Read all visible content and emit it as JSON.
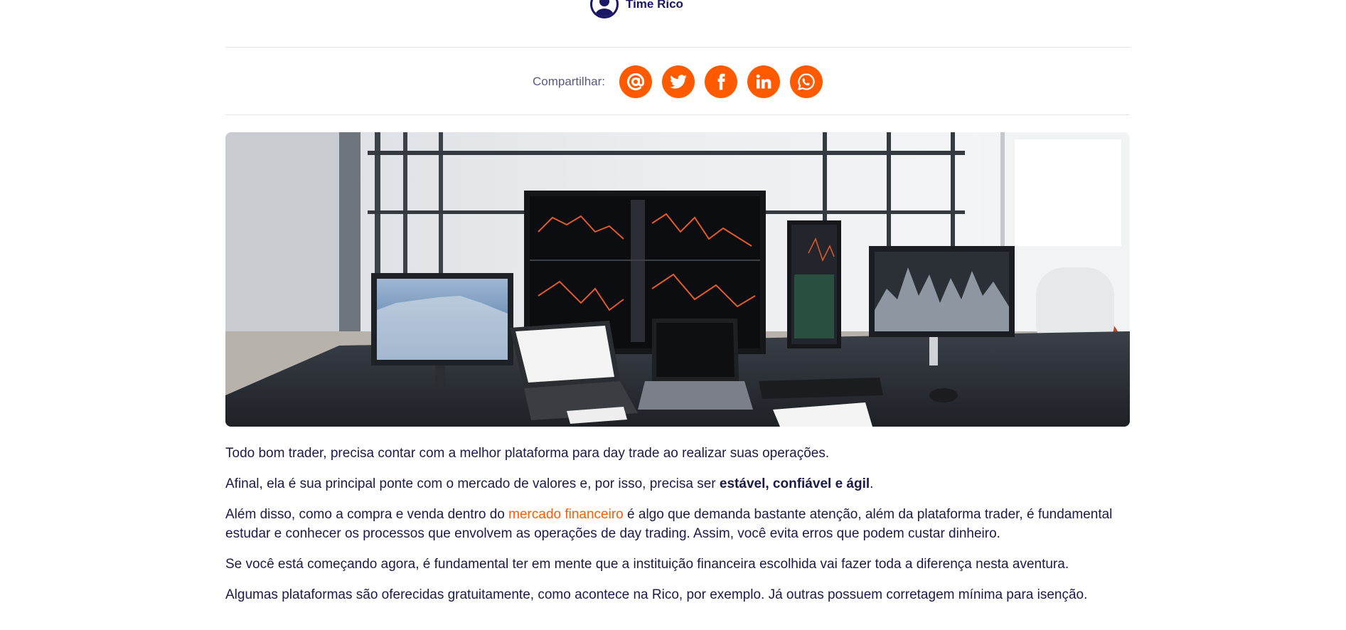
{
  "author": {
    "name": "Time Rico"
  },
  "share": {
    "label": "Compartilhar:",
    "buttons": [
      {
        "name": "email",
        "icon": "at-icon"
      },
      {
        "name": "twitter",
        "icon": "twitter-icon"
      },
      {
        "name": "facebook",
        "icon": "facebook-icon"
      },
      {
        "name": "linkedin",
        "icon": "linkedin-icon"
      },
      {
        "name": "whatsapp",
        "icon": "whatsapp-icon"
      }
    ]
  },
  "colors": {
    "accent": "#ff5a00",
    "text": "#1b1a4a",
    "brand_dark": "#1b1764"
  },
  "article": {
    "p1": "Todo bom trader, precisa contar com a melhor plataforma para day trade ao realizar suas operações.",
    "p2_pre": "Afinal, ela é sua principal ponte com o mercado de valores e, por isso, precisa ser ",
    "p2_bold": "estável, confiável e ágil",
    "p2_post": ".",
    "p3_pre": "Além disso, como a compra e venda dentro do ",
    "p3_link": "mercado financeiro",
    "p3_post": " é algo que demanda bastante atenção, além da plataforma trader, é fundamental estudar e conhecer os processos que envolvem as operações de day trading. Assim, você evita erros que podem custar dinheiro.",
    "p4": "Se você está começando agora, é fundamental ter em mente que a instituição financeira escolhida vai fazer toda a diferença nesta aventura.",
    "p5": "Algumas plataformas são oferecidas gratuitamente, como acontece na Rico, por exemplo. Já outras possuem corretagem mínima para isenção."
  }
}
